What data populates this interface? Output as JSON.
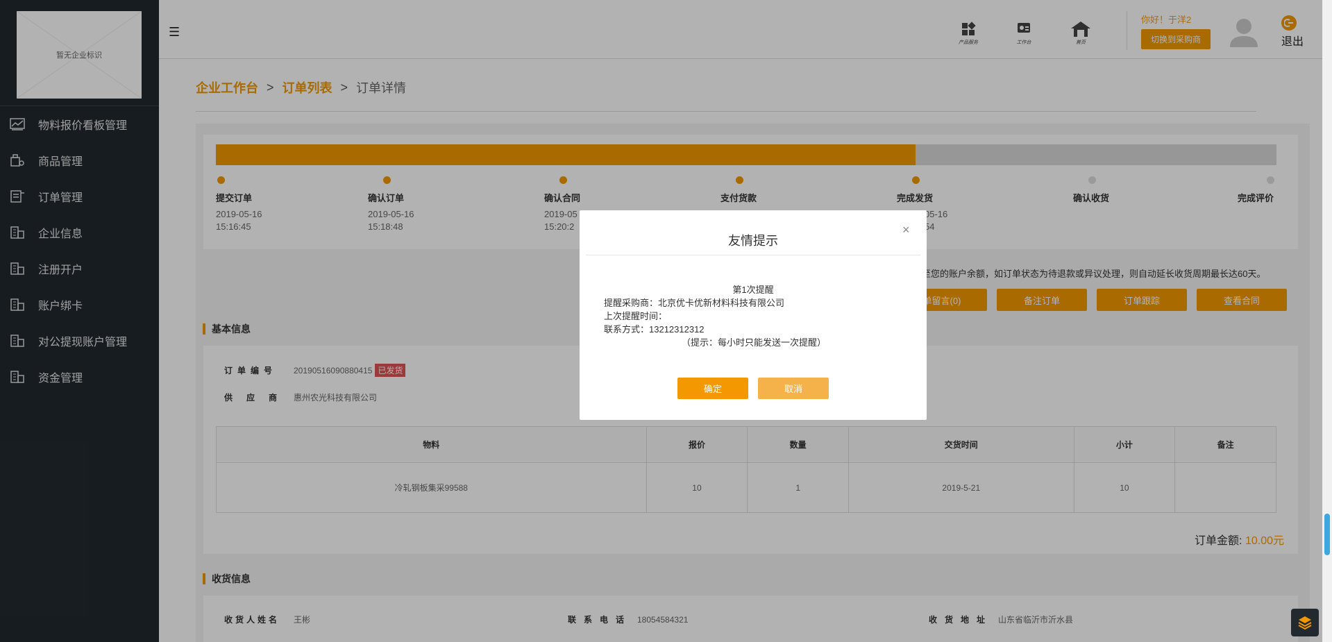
{
  "sidebar": {
    "logo_text": "暂无企业标识",
    "items": [
      {
        "label": "物料报价看板管理",
        "icon": "chart-icon"
      },
      {
        "label": "商品管理",
        "icon": "goods-icon"
      },
      {
        "label": "订单管理",
        "icon": "order-icon"
      },
      {
        "label": "企业信息",
        "icon": "building-icon"
      },
      {
        "label": "注册开户",
        "icon": "building-icon"
      },
      {
        "label": "账户绑卡",
        "icon": "building-icon"
      },
      {
        "label": "对公提现账户管理",
        "icon": "building-icon"
      },
      {
        "label": "资金管理",
        "icon": "building-icon"
      }
    ]
  },
  "header": {
    "icons": [
      {
        "caption": "产品服务",
        "icon": "grid-icon"
      },
      {
        "caption": "工作台",
        "icon": "workbench-icon"
      },
      {
        "caption": "首页",
        "icon": "home-icon"
      }
    ],
    "greeting": "你好！于洋2",
    "switch_label": "切换到采购商",
    "logout_label": "退出"
  },
  "breadcrumb": {
    "item1": "企业工作台",
    "item2": "订单列表",
    "current": "订单详情",
    "sep": ">"
  },
  "progress": {
    "fraction": 0.66,
    "steps": [
      {
        "name": "提交订单",
        "date": "2019-05-16",
        "time": "15:16:45",
        "done": true
      },
      {
        "name": "确认订单",
        "date": "2019-05-16",
        "time": "15:18:48",
        "done": true
      },
      {
        "name": "确认合同",
        "date": "2019-05",
        "time": "15:20:2",
        "done": true
      },
      {
        "name": "支付货款",
        "date": "",
        "time": "",
        "done": true
      },
      {
        "name": "完成发货",
        "date": "05-16",
        "time": "54",
        "done": true
      },
      {
        "name": "确认收货",
        "date": "",
        "time": "",
        "done": false
      },
      {
        "name": "完成评价",
        "date": "",
        "time": "",
        "done": false
      }
    ]
  },
  "notice": "至您的账户余额，如订单状态为待退款或异议处理，则自动延长收货周期最长达60天。",
  "actions": [
    "单留言(0)",
    "备注订单",
    "订单跟踪",
    "查看合同"
  ],
  "basic_info": {
    "title": "基本信息",
    "order_no_label": "订单编号",
    "order_no": "20190516090880415",
    "status": "已发货",
    "supplier_label": "供应商",
    "supplier": "惠州农光科技有限公司"
  },
  "goods_table": {
    "headers": [
      "物料",
      "报价",
      "数量",
      "交货时间",
      "小计",
      "备注"
    ],
    "rows": [
      [
        "冷轧钢板集采99588",
        "10",
        "1",
        "2019-5-21",
        "10",
        ""
      ]
    ]
  },
  "total": {
    "label": "订单金额:",
    "amount": "10.00元"
  },
  "receive_info": {
    "title": "收货信息",
    "name_label": "收货人姓名",
    "name": "王彬",
    "phone_label": "联系电话",
    "phone": "18054584321",
    "addr_label": "收货地址",
    "addr": "山东省临沂市沂水县"
  },
  "dialog": {
    "title": "友情提示",
    "close": "×",
    "line1": "第1次提醒",
    "line2": "提醒采购商：北京优卡优新材料科技有限公司",
    "line3": "上次提醒时间：",
    "line4": "联系方式：13212312312",
    "line5": "（提示：每小时只能发送一次提醒）",
    "ok": "确定",
    "cancel": "取消"
  },
  "colors": {
    "accent": "#f39800",
    "sidebar": "#22292f",
    "status": "#e05454"
  }
}
